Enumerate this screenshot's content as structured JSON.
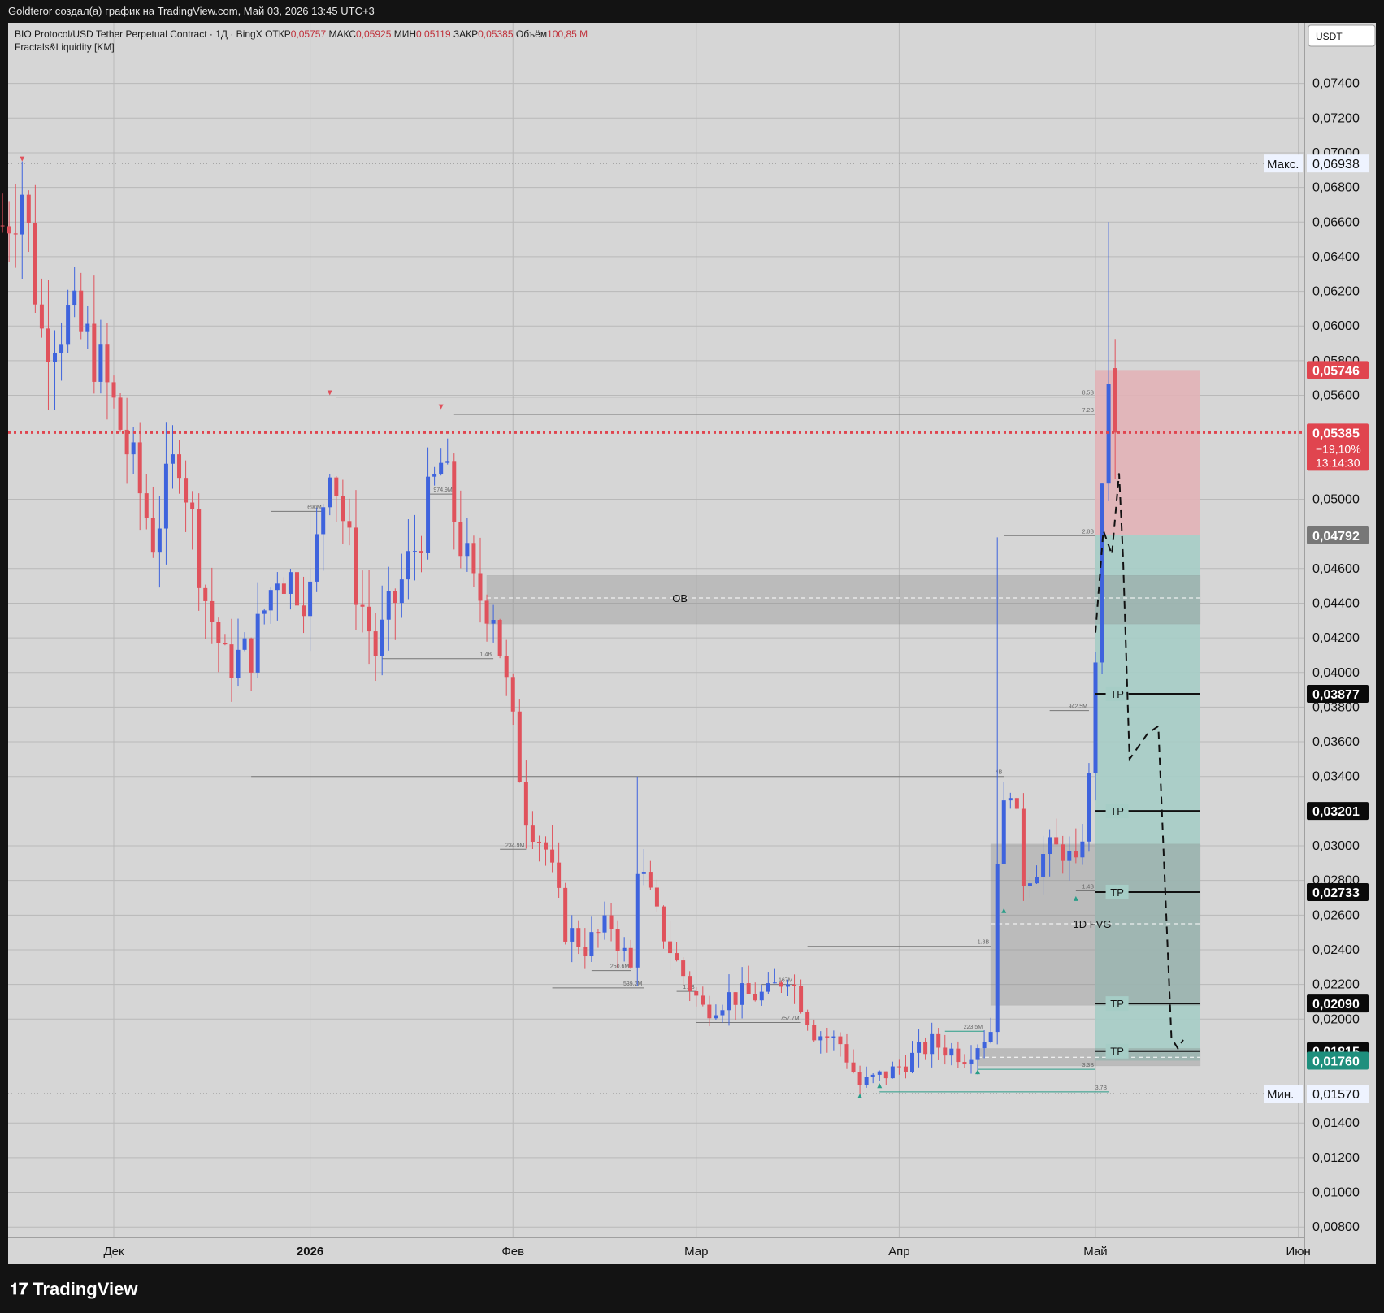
{
  "header": {
    "attribution": "Goldteror создал(а) график на TradingView.com, Май 03, 2026 13:45 UTC+3"
  },
  "legend": {
    "symbol": "BIO Protocol/USD Tether Perpetual Contract · 1Д · BingX",
    "open_label": "ОТКР",
    "open_value": "0,05757",
    "high_label": "МАКС",
    "high_value": "0,05925",
    "low_label": "МИН",
    "low_value": "0,05119",
    "close_label": "ЗАКР",
    "close_value": "0,05385",
    "volume_label": "Объём",
    "volume_value": "100,85 M",
    "indicator": "Fractals&Liquidity [KM]"
  },
  "footer": {
    "brand": "TradingView"
  },
  "colors": {
    "up": "#3e63dd",
    "down": "#e0525c",
    "background": "#d6d6d6",
    "stop_zone": "#e2b3b7",
    "target_zone": "#a6cdc6",
    "ob_zone": "#c0c0c0",
    "price_badge": "#e0454f",
    "entry_badge": "#777777",
    "tp_badge": "#0a0a0a",
    "low_badge": "#1e8f7d"
  },
  "chart_data": {
    "type": "candlestick",
    "currency": "USDT",
    "ylim": [
      0.0074,
      0.0775
    ],
    "y_ticks": [
      {
        "v": 0.074,
        "t": "0,07400"
      },
      {
        "v": 0.072,
        "t": "0,07200"
      },
      {
        "v": 0.07,
        "t": "0,07000"
      },
      {
        "v": 0.068,
        "t": "0,06800"
      },
      {
        "v": 0.066,
        "t": "0,06600"
      },
      {
        "v": 0.064,
        "t": "0,06400"
      },
      {
        "v": 0.062,
        "t": "0,06200"
      },
      {
        "v": 0.06,
        "t": "0,06000"
      },
      {
        "v": 0.058,
        "t": "0,05800"
      },
      {
        "v": 0.056,
        "t": "0,05600"
      },
      {
        "v": 0.05,
        "t": "0,05000"
      },
      {
        "v": 0.046,
        "t": "0,04600"
      },
      {
        "v": 0.044,
        "t": "0,04400"
      },
      {
        "v": 0.042,
        "t": "0,04200"
      },
      {
        "v": 0.04,
        "t": "0,04000"
      },
      {
        "v": 0.038,
        "t": "0,03800"
      },
      {
        "v": 0.036,
        "t": "0,03600"
      },
      {
        "v": 0.034,
        "t": "0,03400"
      },
      {
        "v": 0.03,
        "t": "0,03000"
      },
      {
        "v": 0.028,
        "t": "0,02800"
      },
      {
        "v": 0.026,
        "t": "0,02600"
      },
      {
        "v": 0.024,
        "t": "0,02400"
      },
      {
        "v": 0.022,
        "t": "0,02200"
      },
      {
        "v": 0.02,
        "t": "0,02000"
      },
      {
        "v": 0.014,
        "t": "0,01400"
      },
      {
        "v": 0.012,
        "t": "0,01200"
      },
      {
        "v": 0.01,
        "t": "0,01000"
      },
      {
        "v": 0.008,
        "t": "0,00800"
      }
    ],
    "x_ticks": [
      {
        "t": "Дек",
        "i": 17,
        "bold": false
      },
      {
        "t": "2026",
        "i": 47,
        "bold": true
      },
      {
        "t": "Фев",
        "i": 78,
        "bold": false
      },
      {
        "t": "Мар",
        "i": 106,
        "bold": false
      },
      {
        "t": "Апр",
        "i": 137,
        "bold": false
      },
      {
        "t": "Май",
        "i": 167,
        "bold": false
      },
      {
        "t": "Июн",
        "i": 198,
        "bold": false
      }
    ],
    "current_price": {
      "value": 0.05385,
      "text": "0,05385",
      "change": "−19,10%",
      "countdown": "13:14:30"
    },
    "max_label": {
      "label": "Макс.",
      "value": 0.06938,
      "text": "0,06938"
    },
    "min_label": {
      "label": "Мин.",
      "value": 0.0157,
      "text": "0,01570"
    },
    "position": {
      "entry": 0.04792,
      "entry_text": "0,04792",
      "stop": 0.05746,
      "stop_text": "0,05746",
      "target": 0.0176,
      "target_text": "0,01760",
      "start_i": 167,
      "end_i": 183
    },
    "take_profits": [
      {
        "value": 0.03877,
        "text": "0,03877",
        "label": "TP"
      },
      {
        "value": 0.03201,
        "text": "0,03201",
        "label": "TP"
      },
      {
        "value": 0.02733,
        "text": "0,02733",
        "label": "TP"
      },
      {
        "value": 0.0209,
        "text": "0,02090",
        "label": "TP"
      },
      {
        "value": 0.01815,
        "text": "0,01815",
        "label": "TP"
      }
    ],
    "zones": [
      {
        "label": "OB",
        "top": 0.0456,
        "bottom": 0.0428,
        "mid": 0.0443,
        "start_i": 74,
        "end_i": 183
      },
      {
        "label": "1D FVG",
        "top": 0.0301,
        "bottom": 0.0208,
        "mid": 0.0255,
        "start_i": 151,
        "end_i": 183
      },
      {
        "label": "",
        "top": 0.0183,
        "bottom": 0.0173,
        "mid": 0.0178,
        "start_i": 149,
        "end_i": 183
      }
    ],
    "liquidity_lines": [
      {
        "value": 0.0559,
        "label": "8.5B",
        "start_i": 51,
        "end_i": 167
      },
      {
        "value": 0.0549,
        "label": "7.2B",
        "start_i": 69,
        "end_i": 167
      },
      {
        "value": 0.0503,
        "label": "974.9M",
        "start_i": 65,
        "end_i": 69
      },
      {
        "value": 0.0493,
        "label": "690M",
        "start_i": 41,
        "end_i": 49
      },
      {
        "value": 0.0479,
        "label": "2.8B",
        "start_i": 153,
        "end_i": 167
      },
      {
        "value": 0.0408,
        "label": "1.4B",
        "start_i": 58,
        "end_i": 75
      },
      {
        "value": 0.0378,
        "label": "942.5M",
        "start_i": 160,
        "end_i": 166
      },
      {
        "value": 0.034,
        "label": "4B",
        "start_i": 38,
        "end_i": 153
      },
      {
        "value": 0.0298,
        "label": "234.9M",
        "start_i": 76,
        "end_i": 80
      },
      {
        "value": 0.0274,
        "label": "1.4B",
        "start_i": 164,
        "end_i": 167
      },
      {
        "value": 0.0242,
        "label": "1.3B",
        "start_i": 123,
        "end_i": 151
      },
      {
        "value": 0.0228,
        "label": "250.6M",
        "start_i": 90,
        "end_i": 96
      },
      {
        "value": 0.0218,
        "label": "539.2M",
        "start_i": 84,
        "end_i": 98
      },
      {
        "value": 0.0216,
        "label": "1.7B",
        "start_i": 103,
        "end_i": 106
      },
      {
        "value": 0.022,
        "label": "167M",
        "start_i": 116,
        "end_i": 121
      },
      {
        "value": 0.0198,
        "label": "757.7M",
        "start_i": 106,
        "end_i": 122
      },
      {
        "value": 0.0193,
        "label": "223.5M",
        "start_i": 144,
        "end_i": 150
      },
      {
        "value": 0.0171,
        "label": "3.3B",
        "start_i": 149,
        "end_i": 167
      },
      {
        "value": 0.0158,
        "label": "3.7B",
        "start_i": 134,
        "end_i": 169
      }
    ],
    "projection": [
      [
        167,
        0.0423
      ],
      [
        168.2,
        0.0482
      ],
      [
        169.5,
        0.0468
      ],
      [
        170.6,
        0.0515
      ],
      [
        171.2,
        0.0467
      ],
      [
        172.2,
        0.035
      ],
      [
        175,
        0.0365
      ],
      [
        176.6,
        0.0369
      ],
      [
        178.6,
        0.0189
      ],
      [
        179.6,
        0.0183
      ],
      [
        180.4,
        0.0188
      ]
    ],
    "anchors": [
      {
        "i": 0,
        "p": 0.0658
      },
      {
        "i": 3,
        "p": 0.068
      },
      {
        "i": 6,
        "p": 0.0596
      },
      {
        "i": 10,
        "p": 0.0605
      },
      {
        "i": 14,
        "p": 0.0585
      },
      {
        "i": 18,
        "p": 0.0542
      },
      {
        "i": 23,
        "p": 0.0478
      },
      {
        "i": 27,
        "p": 0.053
      },
      {
        "i": 31,
        "p": 0.0443
      },
      {
        "i": 34,
        "p": 0.0405
      },
      {
        "i": 38,
        "p": 0.0412
      },
      {
        "i": 42,
        "p": 0.046
      },
      {
        "i": 47,
        "p": 0.0445
      },
      {
        "i": 50,
        "p": 0.0528
      },
      {
        "i": 54,
        "p": 0.0451
      },
      {
        "i": 57,
        "p": 0.0412
      },
      {
        "i": 63,
        "p": 0.0472
      },
      {
        "i": 67,
        "p": 0.052
      },
      {
        "i": 72,
        "p": 0.0447
      },
      {
        "i": 75,
        "p": 0.0438
      },
      {
        "i": 80,
        "p": 0.032
      },
      {
        "i": 83,
        "p": 0.0298
      },
      {
        "i": 86,
        "p": 0.0252
      },
      {
        "i": 89,
        "p": 0.0242
      },
      {
        "i": 93,
        "p": 0.0255
      },
      {
        "i": 96,
        "p": 0.0228
      },
      {
        "i": 97,
        "p": 0.0291
      },
      {
        "i": 100,
        "p": 0.0258
      },
      {
        "i": 103,
        "p": 0.0232
      },
      {
        "i": 107,
        "p": 0.0206
      },
      {
        "i": 111,
        "p": 0.0213
      },
      {
        "i": 117,
        "p": 0.0214
      },
      {
        "i": 120,
        "p": 0.0227
      },
      {
        "i": 124,
        "p": 0.0193
      },
      {
        "i": 128,
        "p": 0.0186
      },
      {
        "i": 131,
        "p": 0.0162
      },
      {
        "i": 136,
        "p": 0.017
      },
      {
        "i": 142,
        "p": 0.0186
      },
      {
        "i": 147,
        "p": 0.0179
      },
      {
        "i": 151,
        "p": 0.0194
      },
      {
        "i": 152,
        "p": 0.0297
      },
      {
        "i": 154,
        "p": 0.0339
      },
      {
        "i": 156,
        "p": 0.0282
      },
      {
        "i": 159,
        "p": 0.0294
      },
      {
        "i": 162,
        "p": 0.0299
      },
      {
        "i": 164,
        "p": 0.0284
      },
      {
        "i": 166,
        "p": 0.0335
      },
      {
        "i": 167,
        "p": 0.0413
      },
      {
        "i": 169,
        "p": 0.0574
      },
      {
        "i": 170,
        "p": 0.0539
      }
    ]
  }
}
